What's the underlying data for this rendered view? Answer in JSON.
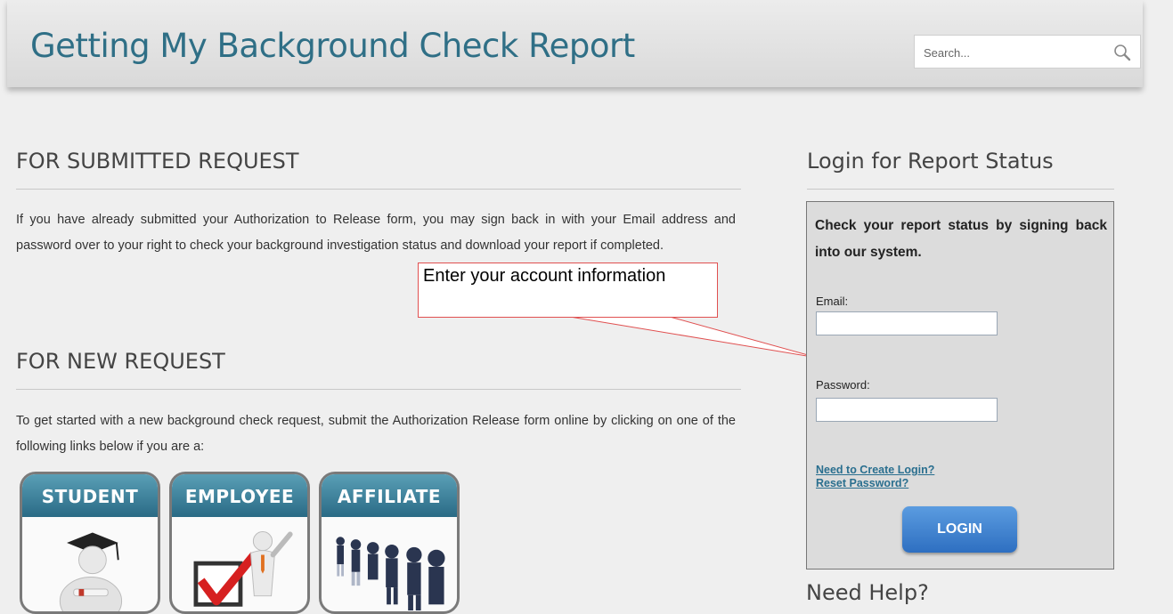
{
  "header": {
    "title": "Getting My Background Check Report",
    "search_placeholder": "Search..."
  },
  "submitted": {
    "heading": "FOR SUBMITTED REQUEST",
    "text": "If you have already submitted your Authorization to Release form, you may sign back in with your Email address and password over to your right to check your background investigation status and download your report if completed."
  },
  "new_request": {
    "heading": "FOR NEW REQUEST",
    "text": "To get started with a new background check request, submit the Authorization Release form online by clicking on one of the following links below if you are a:",
    "tiles": [
      "STUDENT",
      "EMPLOYEE",
      "AFFILIATE"
    ]
  },
  "callout": {
    "text": "Enter your account information"
  },
  "login": {
    "heading": "Login for Report Status",
    "intro": "Check your report status by signing back into our system.",
    "email_label": "Email:",
    "email_value": "",
    "password_label": "Password:",
    "password_value": "",
    "create_link": "Need to Create Login?",
    "reset_link": "Reset Password?",
    "button": "LOGIN"
  },
  "help": {
    "heading": "Need Help?"
  },
  "colors": {
    "title": "#2f6f86",
    "tile_header": "#3a8099",
    "login_button": "#3f82d0",
    "link": "#2a6f8f",
    "callout_border": "#e05050"
  }
}
